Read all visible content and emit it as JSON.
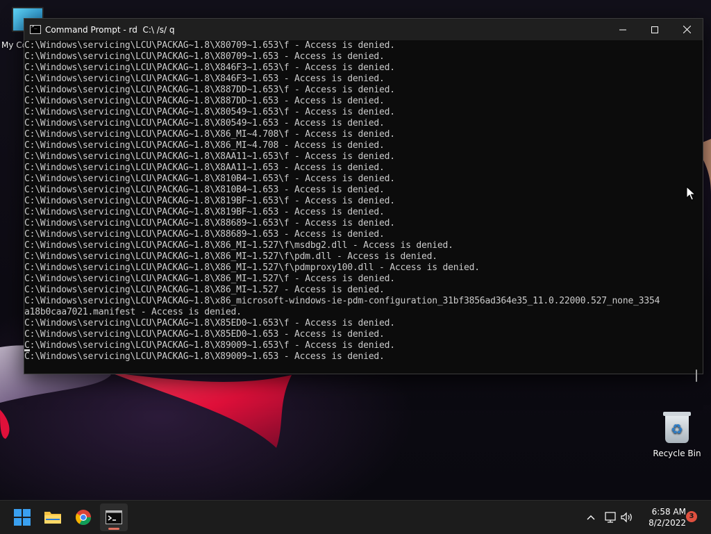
{
  "window": {
    "title": "Command Prompt - rd  C:\\ /s/ q"
  },
  "console_lines": [
    "C:\\Windows\\servicing\\LCU\\PACKAG~1.8\\X80709~1.653\\f - Access is denied.",
    "C:\\Windows\\servicing\\LCU\\PACKAG~1.8\\X80709~1.653 - Access is denied.",
    "C:\\Windows\\servicing\\LCU\\PACKAG~1.8\\X846F3~1.653\\f - Access is denied.",
    "C:\\Windows\\servicing\\LCU\\PACKAG~1.8\\X846F3~1.653 - Access is denied.",
    "C:\\Windows\\servicing\\LCU\\PACKAG~1.8\\X887DD~1.653\\f - Access is denied.",
    "C:\\Windows\\servicing\\LCU\\PACKAG~1.8\\X887DD~1.653 - Access is denied.",
    "C:\\Windows\\servicing\\LCU\\PACKAG~1.8\\X80549~1.653\\f - Access is denied.",
    "C:\\Windows\\servicing\\LCU\\PACKAG~1.8\\X80549~1.653 - Access is denied.",
    "C:\\Windows\\servicing\\LCU\\PACKAG~1.8\\X86_MI~4.708\\f - Access is denied.",
    "C:\\Windows\\servicing\\LCU\\PACKAG~1.8\\X86_MI~4.708 - Access is denied.",
    "C:\\Windows\\servicing\\LCU\\PACKAG~1.8\\X8AA11~1.653\\f - Access is denied.",
    "C:\\Windows\\servicing\\LCU\\PACKAG~1.8\\X8AA11~1.653 - Access is denied.",
    "C:\\Windows\\servicing\\LCU\\PACKAG~1.8\\X810B4~1.653\\f - Access is denied.",
    "C:\\Windows\\servicing\\LCU\\PACKAG~1.8\\X810B4~1.653 - Access is denied.",
    "C:\\Windows\\servicing\\LCU\\PACKAG~1.8\\X819BF~1.653\\f - Access is denied.",
    "C:\\Windows\\servicing\\LCU\\PACKAG~1.8\\X819BF~1.653 - Access is denied.",
    "C:\\Windows\\servicing\\LCU\\PACKAG~1.8\\X88689~1.653\\f - Access is denied.",
    "C:\\Windows\\servicing\\LCU\\PACKAG~1.8\\X88689~1.653 - Access is denied.",
    "C:\\Windows\\servicing\\LCU\\PACKAG~1.8\\X86_MI~1.527\\f\\msdbg2.dll - Access is denied.",
    "C:\\Windows\\servicing\\LCU\\PACKAG~1.8\\X86_MI~1.527\\f\\pdm.dll - Access is denied.",
    "C:\\Windows\\servicing\\LCU\\PACKAG~1.8\\X86_MI~1.527\\f\\pdmproxy100.dll - Access is denied.",
    "C:\\Windows\\servicing\\LCU\\PACKAG~1.8\\X86_MI~1.527\\f - Access is denied.",
    "C:\\Windows\\servicing\\LCU\\PACKAG~1.8\\X86_MI~1.527 - Access is denied.",
    "C:\\Windows\\servicing\\LCU\\PACKAG~1.8\\x86_microsoft-windows-ie-pdm-configuration_31bf3856ad364e35_11.0.22000.527_none_3354",
    "a18b0caa7021.manifest - Access is denied.",
    "C:\\Windows\\servicing\\LCU\\PACKAG~1.8\\X85ED0~1.653\\f - Access is denied.",
    "C:\\Windows\\servicing\\LCU\\PACKAG~1.8\\X85ED0~1.653 - Access is denied.",
    "C:\\Windows\\servicing\\LCU\\PACKAG~1.8\\X89009~1.653\\f - Access is denied.",
    "C:\\Windows\\servicing\\LCU\\PACKAG~1.8\\X89009~1.653 - Access is denied."
  ],
  "desktop": {
    "my_computer_label": "My Cc",
    "recycle_bin_label": "Recycle Bin"
  },
  "taskbar": {
    "time": "6:58 AM",
    "date": "8/2/2022",
    "notification_count": "3"
  },
  "colors": {
    "console_bg": "#0c0c0c",
    "console_text": "#cccccc",
    "titlebar_bg": "#1f1f1f",
    "taskbar_bg": "#1c1c1c",
    "notif_badge": "#e0503f"
  },
  "icons": {
    "start": "windows-logo-icon",
    "explorer": "folder-icon",
    "browser": "chrome-icon",
    "terminal": "terminal-icon",
    "tray_overflow": "chevron-up-icon",
    "network": "network-icon",
    "volume": "volume-icon"
  }
}
